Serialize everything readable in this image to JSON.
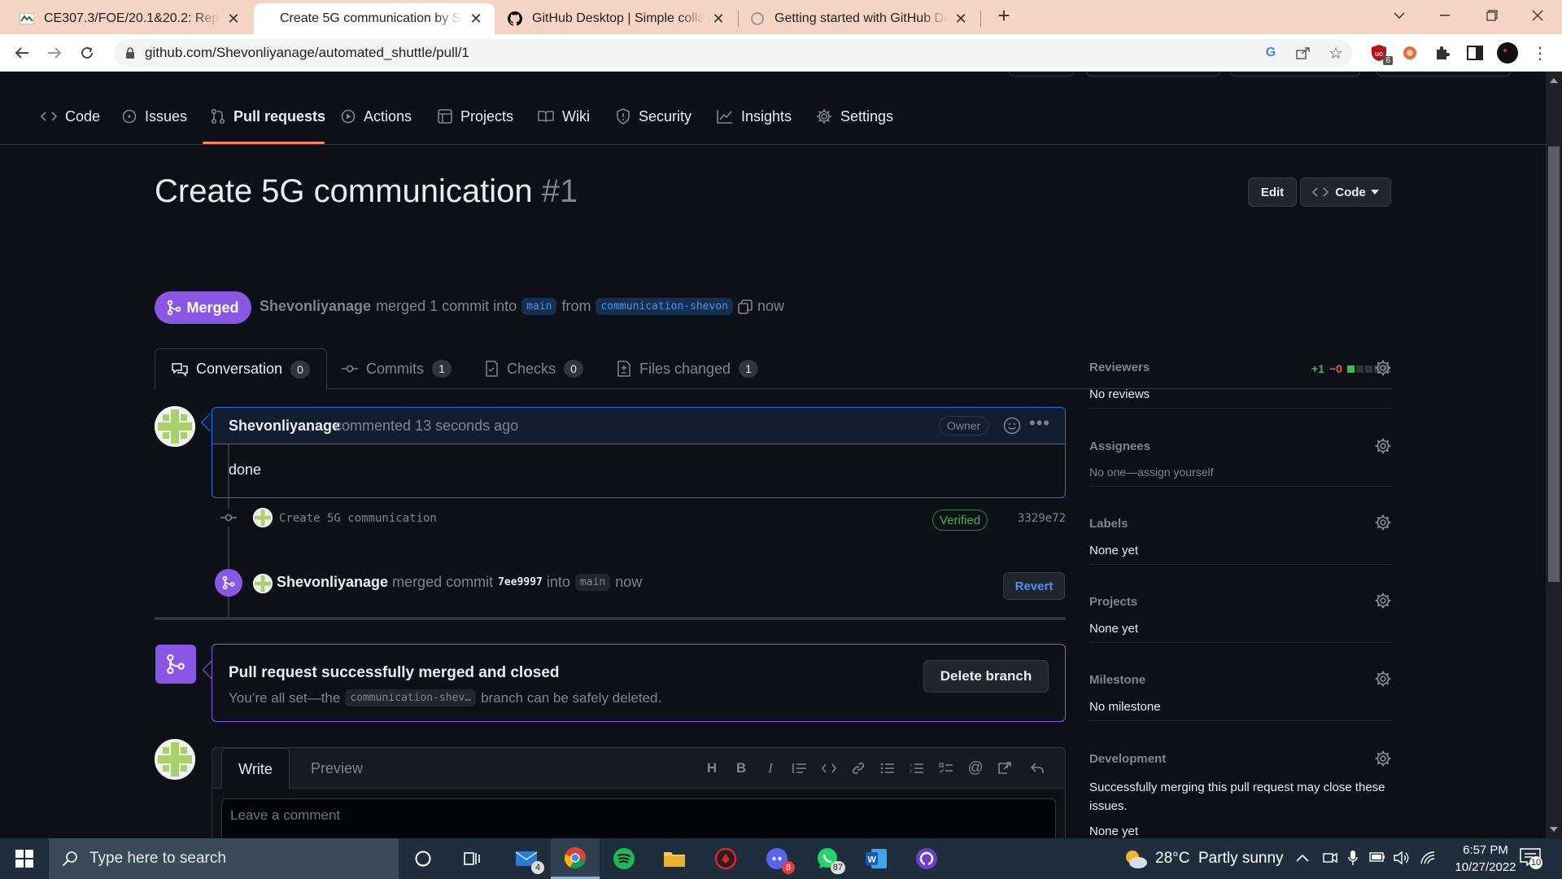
{
  "browser": {
    "tabs": [
      {
        "title": "CE307.3/FOE/20.1&20.2: Repository",
        "active": false
      },
      {
        "title": "Create 5G communication by Shevonliyanage",
        "active": true
      },
      {
        "title": "GitHub Desktop | Simple collaboration",
        "active": false
      },
      {
        "title": "Getting started with GitHub Desktop",
        "active": false
      }
    ],
    "url": "github.com/Shevonliyanage/automated_shuttle/pull/1",
    "extension_badge": "6"
  },
  "repo_nav": {
    "items": [
      {
        "label": "Code",
        "icon": "code-icon"
      },
      {
        "label": "Issues",
        "icon": "issue-icon"
      },
      {
        "label": "Pull requests",
        "icon": "pull-request-icon"
      },
      {
        "label": "Actions",
        "icon": "play-icon"
      },
      {
        "label": "Projects",
        "icon": "table-icon"
      },
      {
        "label": "Wiki",
        "icon": "book-icon"
      },
      {
        "label": "Security",
        "icon": "shield-icon"
      },
      {
        "label": "Insights",
        "icon": "graph-icon"
      },
      {
        "label": "Settings",
        "icon": "gear-icon"
      }
    ]
  },
  "pr": {
    "title": "Create 5G communication",
    "number": "#1",
    "edit_label": "Edit",
    "code_label": "Code",
    "status": "Merged",
    "author": "Shevonliyanage",
    "merged_text": "merged 1 commit into",
    "base_branch": "main",
    "from_text": "from",
    "head_branch": "communication-shevon",
    "time": "now"
  },
  "pr_tabs": [
    {
      "label": "Conversation",
      "count": "0"
    },
    {
      "label": "Commits",
      "count": "1"
    },
    {
      "label": "Checks",
      "count": "0"
    },
    {
      "label": "Files changed",
      "count": "1"
    }
  ],
  "diffstat": {
    "additions": "+1",
    "deletions": "−0"
  },
  "comment": {
    "author": "Shevonliyanage",
    "action": "commented",
    "time": "13 seconds ago",
    "badge": "Owner",
    "body": "done"
  },
  "commit": {
    "message": "Create 5G communication",
    "verified": "Verified",
    "sha": "3329e72"
  },
  "merge_event": {
    "author": "Shevonliyanage",
    "text_merged": "merged commit",
    "sha": "7ee9997",
    "text_into": "into",
    "branch": "main",
    "time": "now",
    "revert_label": "Revert"
  },
  "merge_box": {
    "title": "Pull request successfully merged and closed",
    "desc_pre": "You’re all set—the",
    "branch": "communication-shev…",
    "desc_post": "branch can be safely deleted.",
    "delete_label": "Delete branch"
  },
  "editor": {
    "write_tab": "Write",
    "preview_tab": "Preview",
    "placeholder": "Leave a comment"
  },
  "sidebar": {
    "reviewers": {
      "heading": "Reviewers",
      "value": "No reviews"
    },
    "assignees": {
      "heading": "Assignees",
      "value_pre": "No one—",
      "value_link": "assign yourself"
    },
    "labels": {
      "heading": "Labels",
      "value": "None yet"
    },
    "projects": {
      "heading": "Projects",
      "value": "None yet"
    },
    "milestone": {
      "heading": "Milestone",
      "value": "No milestone"
    },
    "development": {
      "heading": "Development",
      "value": "Successfully merging this pull request may close these issues.",
      "value2": "None yet"
    }
  },
  "taskbar": {
    "search_placeholder": "Type here to search",
    "mail_badge": "4",
    "discord_badge": "8",
    "whatsapp_badge": "87",
    "weather": "28°C  Partly sunny",
    "time": "6:57 PM",
    "date": "10/27/2022",
    "notifications": "10"
  },
  "colors": {
    "merged_purple": "#8957e5",
    "accent_blue": "#1f6feb",
    "verified_green": "#3fb950",
    "tab_underline": "#f78166",
    "tabbar_bg": "#f5d4c4"
  }
}
